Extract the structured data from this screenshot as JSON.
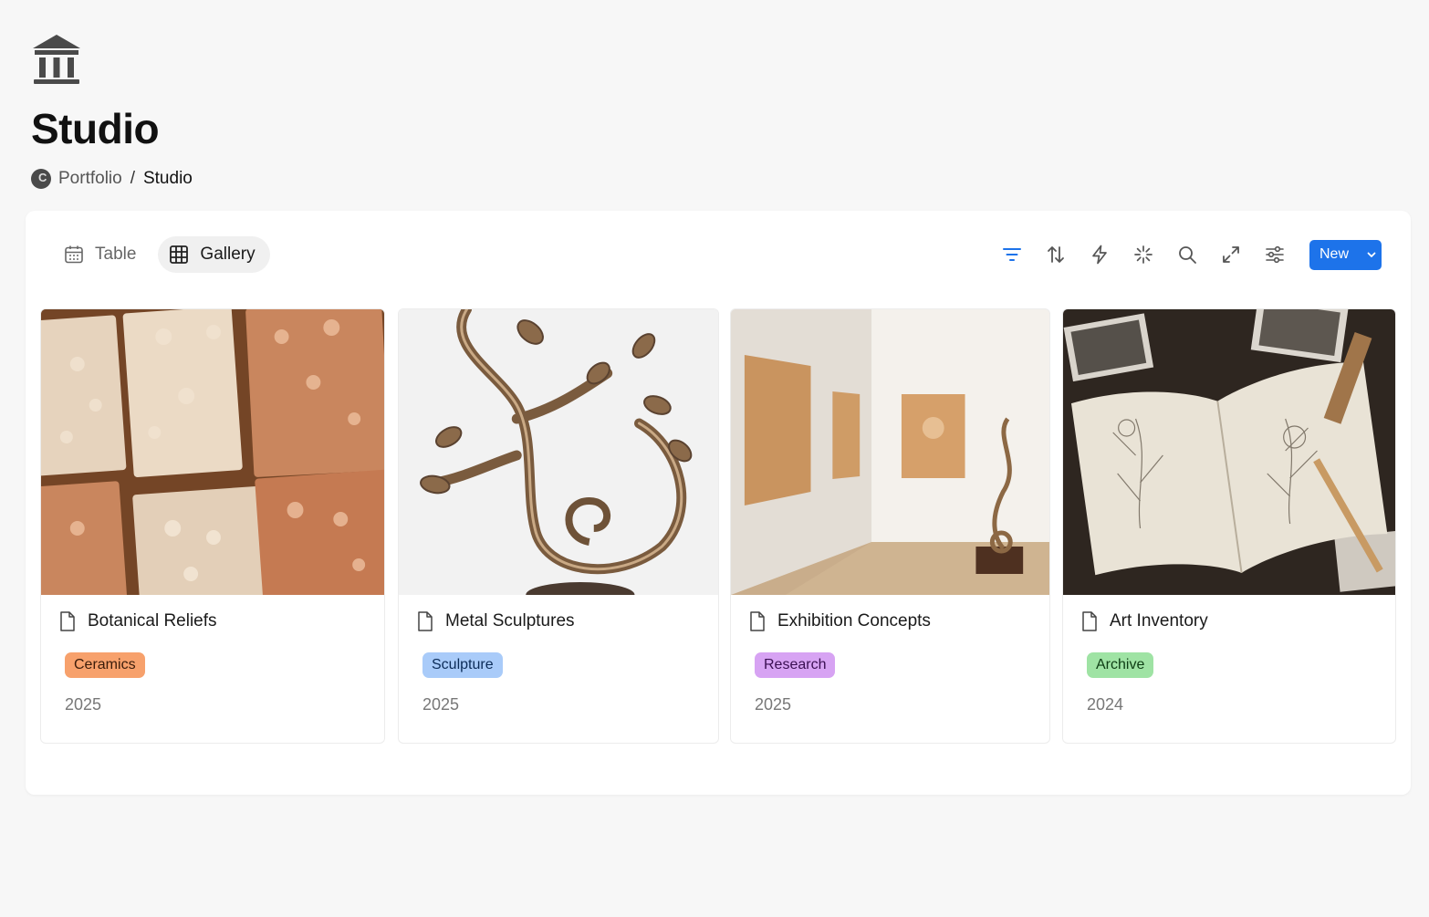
{
  "page": {
    "icon": "museum-building-icon",
    "title": "Studio"
  },
  "breadcrumb": {
    "icon": "workspace-avatar-icon",
    "parent": "Portfolio",
    "separator": "/",
    "current": "Studio"
  },
  "views": [
    {
      "label": "Table",
      "icon": "calendar-table-icon",
      "active": false
    },
    {
      "label": "Gallery",
      "icon": "grid-icon",
      "active": true
    }
  ],
  "toolbar": {
    "tools": [
      "filter-icon",
      "sort-icon",
      "automation-bolt-icon",
      "ai-sparkle-icon",
      "search-icon",
      "expand-icon",
      "settings-sliders-icon"
    ],
    "new_label": "New",
    "accent": "#1d73ea"
  },
  "cards": [
    {
      "title": "Botanical Reliefs",
      "tag": "Ceramics",
      "tag_bg": "#f7a16c",
      "tag_fg": "#3a1c0a",
      "year": "2025",
      "image": "ceramic-floral-tiles"
    },
    {
      "title": "Metal Sculptures",
      "tag": "Sculpture",
      "tag_bg": "#a9cbf9",
      "tag_fg": "#0c2c58",
      "year": "2025",
      "image": "bronze-vine-sculpture"
    },
    {
      "title": "Exhibition Concepts",
      "tag": "Research",
      "tag_bg": "#d7a3f3",
      "tag_fg": "#3a0f52",
      "year": "2025",
      "image": "gallery-room"
    },
    {
      "title": "Art Inventory",
      "tag": "Archive",
      "tag_bg": "#9fe3a4",
      "tag_fg": "#0e3d14",
      "year": "2024",
      "image": "botanical-sketchbook"
    }
  ]
}
